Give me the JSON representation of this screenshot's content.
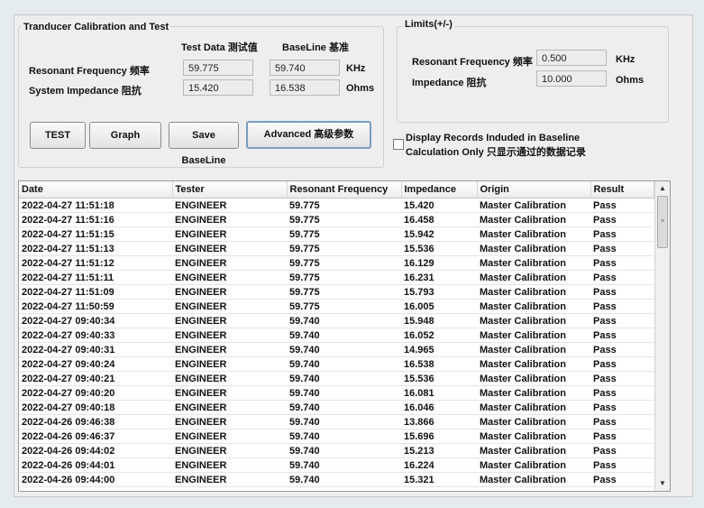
{
  "calibration": {
    "title": "Tranducer Calibration and Test",
    "col_test_data": "Test Data 测试值",
    "col_baseline": "BaseLine 基准",
    "resonant_label": "Resonant Frequency 频率",
    "resonant_test": "59.775",
    "resonant_baseline": "59.740",
    "resonant_unit": "KHz",
    "impedance_label": "System Impedance 阻抗",
    "impedance_test": "15.420",
    "impedance_baseline": "16.538",
    "impedance_unit": "Ohms",
    "buttons": {
      "test": "TEST",
      "graph": "Graph",
      "save_baseline": "Save BaseLine",
      "advanced": "Advanced 高级参数"
    }
  },
  "limits": {
    "title": "Limits(+/-)",
    "resonant_label": "Resonant Frequency 频率",
    "resonant_value": "0.500",
    "resonant_unit": "KHz",
    "impedance_label": "Impedance 阻抗",
    "impedance_value": "10.000",
    "impedance_unit": "Ohms"
  },
  "display_option": {
    "line1": "Display Records Induded in Baseline",
    "line2": "Calculation Only 只显示通过的数据记录",
    "checked": false
  },
  "table": {
    "columns": [
      "Date",
      "Tester",
      "Resonant Frequency",
      "Impedance",
      "Origin",
      "Result"
    ],
    "rows": [
      [
        "2022-04-27 11:51:18",
        "ENGINEER",
        "59.775",
        "15.420",
        "Master Calibration",
        "Pass"
      ],
      [
        "2022-04-27 11:51:16",
        "ENGINEER",
        "59.775",
        "16.458",
        "Master Calibration",
        "Pass"
      ],
      [
        "2022-04-27 11:51:15",
        "ENGINEER",
        "59.775",
        "15.942",
        "Master Calibration",
        "Pass"
      ],
      [
        "2022-04-27 11:51:13",
        "ENGINEER",
        "59.775",
        "15.536",
        "Master Calibration",
        "Pass"
      ],
      [
        "2022-04-27 11:51:12",
        "ENGINEER",
        "59.775",
        "16.129",
        "Master Calibration",
        "Pass"
      ],
      [
        "2022-04-27 11:51:11",
        "ENGINEER",
        "59.775",
        "16.231",
        "Master Calibration",
        "Pass"
      ],
      [
        "2022-04-27 11:51:09",
        "ENGINEER",
        "59.775",
        "15.793",
        "Master Calibration",
        "Pass"
      ],
      [
        "2022-04-27 11:50:59",
        "ENGINEER",
        "59.775",
        "16.005",
        "Master Calibration",
        "Pass"
      ],
      [
        "2022-04-27 09:40:34",
        "ENGINEER",
        "59.740",
        "15.948",
        "Master Calibration",
        "Pass"
      ],
      [
        "2022-04-27 09:40:33",
        "ENGINEER",
        "59.740",
        "16.052",
        "Master Calibration",
        "Pass"
      ],
      [
        "2022-04-27 09:40:31",
        "ENGINEER",
        "59.740",
        "14.965",
        "Master Calibration",
        "Pass"
      ],
      [
        "2022-04-27 09:40:24",
        "ENGINEER",
        "59.740",
        "16.538",
        "Master Calibration",
        "Pass"
      ],
      [
        "2022-04-27 09:40:21",
        "ENGINEER",
        "59.740",
        "15.536",
        "Master Calibration",
        "Pass"
      ],
      [
        "2022-04-27 09:40:20",
        "ENGINEER",
        "59.740",
        "16.081",
        "Master Calibration",
        "Pass"
      ],
      [
        "2022-04-27 09:40:18",
        "ENGINEER",
        "59.740",
        "16.046",
        "Master Calibration",
        "Pass"
      ],
      [
        "2022-04-26 09:46:38",
        "ENGINEER",
        "59.740",
        "13.866",
        "Master Calibration",
        "Pass"
      ],
      [
        "2022-04-26 09:46:37",
        "ENGINEER",
        "59.740",
        "15.696",
        "Master Calibration",
        "Pass"
      ],
      [
        "2022-04-26 09:44:02",
        "ENGINEER",
        "59.740",
        "15.213",
        "Master Calibration",
        "Pass"
      ],
      [
        "2022-04-26 09:44:01",
        "ENGINEER",
        "59.740",
        "16.224",
        "Master Calibration",
        "Pass"
      ],
      [
        "2022-04-26 09:44:00",
        "ENGINEER",
        "59.740",
        "15.321",
        "Master Calibration",
        "Pass"
      ]
    ]
  },
  "scrollbar": {
    "up_icon": "▲",
    "down_icon": "▼",
    "grip_icon": "≡"
  }
}
